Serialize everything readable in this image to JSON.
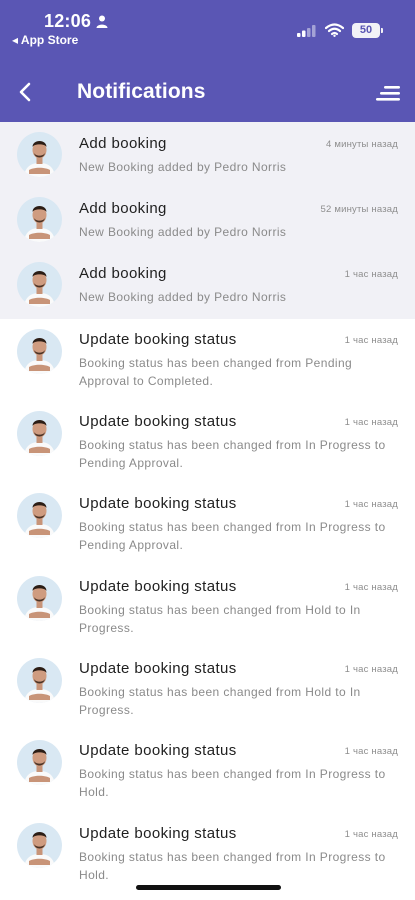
{
  "status_bar": {
    "time": "12:06",
    "back_app": "◂ App Store",
    "battery": "50"
  },
  "header": {
    "title": "Notifications"
  },
  "notifications": [
    {
      "title": "Add booking",
      "time": "4 минуты назад",
      "description": "New Booking added by Pedro Norris",
      "unread": true
    },
    {
      "title": "Add booking",
      "time": "52 минуты назад",
      "description": "New Booking added by Pedro Norris",
      "unread": true
    },
    {
      "title": "Add booking",
      "time": "1 час назад",
      "description": "New Booking added by Pedro Norris",
      "unread": true
    },
    {
      "title": "Update booking status",
      "time": "1 час назад",
      "description": "Booking status has been changed from Pending Approval to Completed.",
      "unread": false
    },
    {
      "title": "Update booking status",
      "time": "1 час назад",
      "description": "Booking status has been changed from In Progress to Pending Approval.",
      "unread": false
    },
    {
      "title": "Update booking status",
      "time": "1 час назад",
      "description": "Booking status has been changed from In Progress to Pending Approval.",
      "unread": false
    },
    {
      "title": "Update booking status",
      "time": "1 час назад",
      "description": "Booking status has been changed from Hold to In Progress.",
      "unread": false
    },
    {
      "title": "Update booking status",
      "time": "1 час назад",
      "description": "Booking status has been changed from Hold to In Progress.",
      "unread": false
    },
    {
      "title": "Update booking status",
      "time": "1 час назад",
      "description": "Booking status has been changed from In Progress to Hold.",
      "unread": false
    },
    {
      "title": "Update booking status",
      "time": "1 час назад",
      "description": "Booking status has been changed from In Progress to Hold.",
      "unread": false
    }
  ],
  "colors": {
    "header_bg": "#5a56b4",
    "unread_bg": "#f1f1f6",
    "avatar_bg": "#d9e8f3"
  },
  "icons": {
    "back": "chevron-left-icon",
    "filter": "sort-lines-icon",
    "person": "person-icon",
    "signal": "cellular-signal-icon",
    "wifi": "wifi-icon",
    "battery": "battery-icon"
  }
}
